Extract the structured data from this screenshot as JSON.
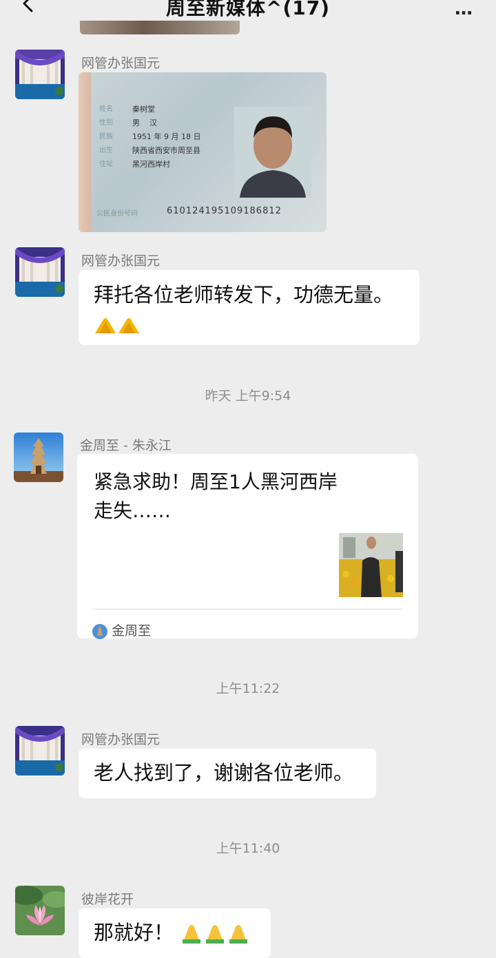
{
  "header": {
    "title": "周至新媒体^(17)",
    "back_icon": "back-chevron-icon",
    "more_icon": "more-icon",
    "more_label": "…"
  },
  "messages": [
    {
      "sender": "网管办张国元",
      "type": "image",
      "image": "id-card-photo",
      "avatar": "stage-curtain-avatar"
    },
    {
      "sender": "网管办张国元",
      "type": "text",
      "text": "拜托各位老师转发下，功德无量。",
      "emoji": [
        "pray-hands-icon",
        "pray-hands-icon"
      ],
      "avatar": "stage-curtain-avatar"
    },
    {
      "sender": "金周至 - 朱永江",
      "type": "link",
      "title": "紧急求助！周至1人黑河西岸走失……",
      "source": "金周至",
      "thumbnail": "person-in-flower-field",
      "avatar": "pagoda-avatar"
    },
    {
      "sender": "网管办张国元",
      "type": "text",
      "text": "老人找到了，谢谢各位老师。",
      "avatar": "stage-curtain-avatar"
    },
    {
      "sender": "彼岸花开",
      "type": "text",
      "text": "那就好！",
      "emoji": [
        "folded-hands-icon",
        "folded-hands-icon",
        "folded-hands-icon"
      ],
      "avatar": "lotus-avatar"
    }
  ],
  "timestamps": [
    "昨天 上午9:54",
    "上午11:22",
    "上午11:40"
  ],
  "id_card": {
    "labels": [
      "姓名",
      "性别",
      "民族",
      "出生",
      "住址",
      "公民身份号码"
    ],
    "name": "秦树堂",
    "sex": "男",
    "ethnicity": "汉",
    "birth": "1951 年 9 月 18 日",
    "address_line1": "陕西省西安市周至县",
    "address_line2": "黑河西岸村",
    "number": "610124195109186812"
  },
  "colors": {
    "background": "#ededed",
    "bubble": "#ffffff",
    "meta_text": "#8d8d8d"
  }
}
